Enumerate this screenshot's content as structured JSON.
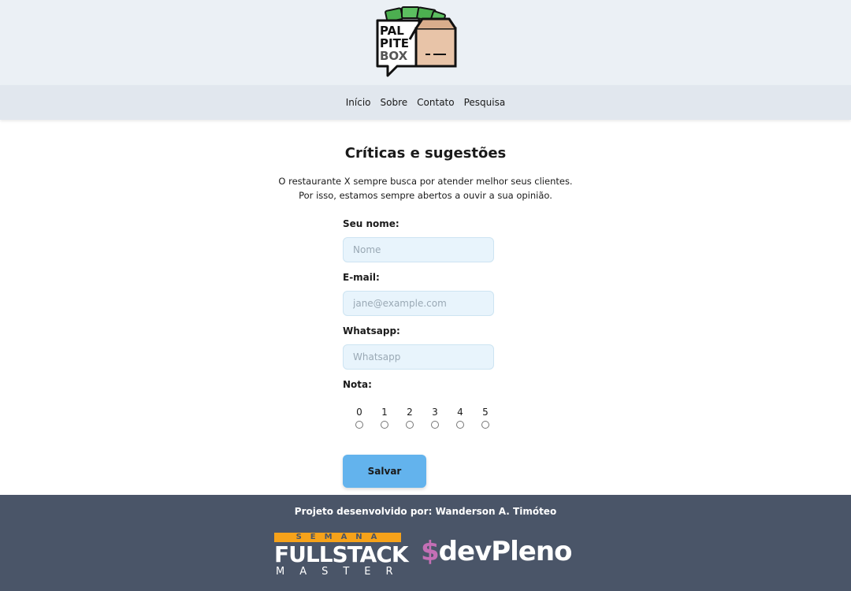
{
  "brand": {
    "logo_line1": "PAL",
    "logo_line2": "PITE",
    "logo_line3": "BOX"
  },
  "nav": {
    "items": [
      {
        "label": "Início"
      },
      {
        "label": "Sobre"
      },
      {
        "label": "Contato"
      },
      {
        "label": "Pesquisa"
      }
    ]
  },
  "main": {
    "title": "Críticas e sugestões",
    "intro_line1": "O restaurante X sempre busca por atender melhor seus clientes.",
    "intro_line2": "Por isso, estamos sempre abertos a ouvir a sua opinião."
  },
  "form": {
    "name_label": "Seu nome:",
    "name_placeholder": "Nome",
    "email_label": "E-mail:",
    "email_placeholder": "jane@example.com",
    "whatsapp_label": "Whatsapp:",
    "whatsapp_placeholder": "Whatsapp",
    "rating_label": "Nota:",
    "ratings": [
      "0",
      "1",
      "2",
      "3",
      "4",
      "5"
    ],
    "save_label": "Salvar"
  },
  "footer": {
    "credit": "Projeto desenvolvido por: Wanderson A. Timóteo",
    "fsm_semana": "SEMANA",
    "fsm_fullstack": "FULLSTACK",
    "fsm_master": "MASTER",
    "devpleno_dollar": "$",
    "devpleno_text": "devPleno"
  },
  "colors": {
    "header_bg": "#ebf0f5",
    "nav_bg": "#e1e7ee",
    "input_bg": "#e8f4fc",
    "button_bg": "#63b3ed",
    "footer_bg": "#4a5568",
    "semana_orange": "#f6a21a",
    "devpleno_pink": "#c46fb5"
  }
}
